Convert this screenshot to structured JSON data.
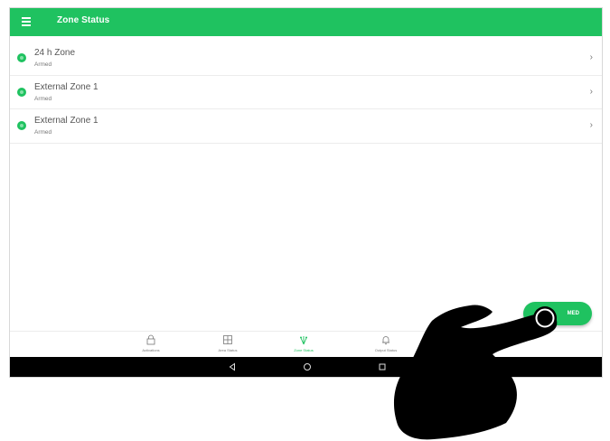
{
  "app": {
    "title": "Zone Status"
  },
  "zones": [
    {
      "name": "24 h Zone",
      "state": "Armed"
    },
    {
      "name": "External Zone 1",
      "state": "Armed"
    },
    {
      "name": "External Zone 1",
      "state": "Armed"
    }
  ],
  "nav": [
    {
      "label": "Activations",
      "icon": "lock-icon"
    },
    {
      "label": "Area Status",
      "icon": "grid-icon"
    },
    {
      "label": "Zone Status",
      "icon": "zones-icon",
      "active": true
    },
    {
      "label": "Output Status",
      "icon": "bell-icon"
    }
  ],
  "fab": {
    "label": "MED"
  },
  "colors": {
    "accent": "#1fc260",
    "system_bar": "#000000"
  }
}
